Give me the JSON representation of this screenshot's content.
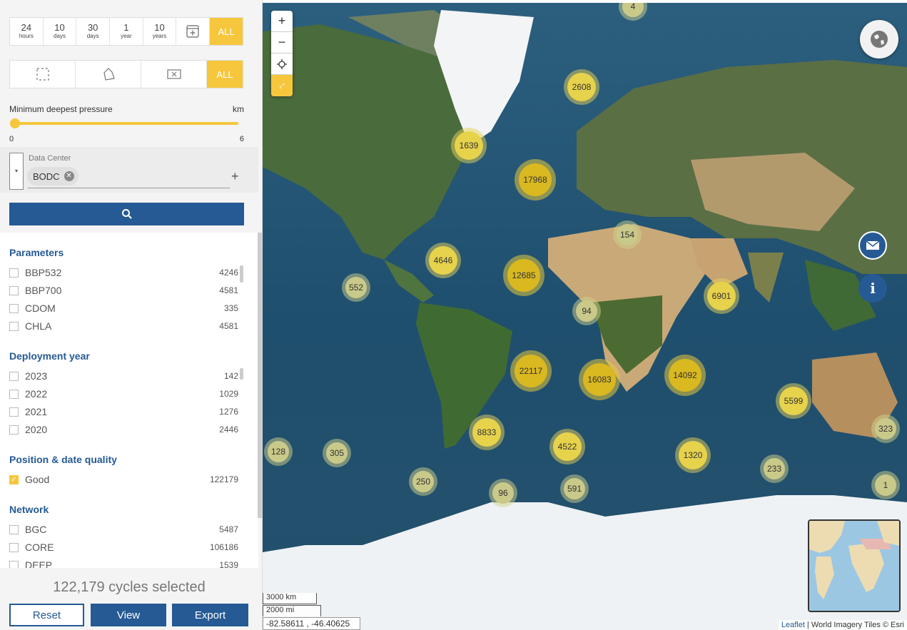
{
  "time_filter": {
    "options": [
      {
        "big": "24",
        "small": "hours"
      },
      {
        "big": "10",
        "small": "days"
      },
      {
        "big": "30",
        "small": "days"
      },
      {
        "big": "1",
        "small": "year"
      },
      {
        "big": "10",
        "small": "years"
      }
    ],
    "all_label": "ALL"
  },
  "shape_filter": {
    "all_label": "ALL"
  },
  "pressure": {
    "label": "Minimum deepest pressure",
    "unit": "km",
    "min": "0",
    "max": "6",
    "value": 0
  },
  "data_center": {
    "label": "Data Center",
    "chip": "BODC"
  },
  "facets": {
    "parameters": {
      "title": "Parameters",
      "items": [
        {
          "name": "BBP532",
          "count": "4246"
        },
        {
          "name": "BBP700",
          "count": "4581"
        },
        {
          "name": "CDOM",
          "count": "335"
        },
        {
          "name": "CHLA",
          "count": "4581"
        }
      ]
    },
    "deployment_year": {
      "title": "Deployment year",
      "items": [
        {
          "name": "2023",
          "count": "142"
        },
        {
          "name": "2022",
          "count": "1029"
        },
        {
          "name": "2021",
          "count": "1276"
        },
        {
          "name": "2020",
          "count": "2446"
        }
      ]
    },
    "quality": {
      "title": "Position & date quality",
      "items": [
        {
          "name": "Good",
          "count": "122179",
          "checked": true
        }
      ]
    },
    "network": {
      "title": "Network",
      "items": [
        {
          "name": "BGC",
          "count": "5487"
        },
        {
          "name": "CORE",
          "count": "106186"
        },
        {
          "name": "DEEP",
          "count": "1539"
        }
      ]
    }
  },
  "summary": {
    "cycles_selected": "122,179 cycles selected"
  },
  "actions": {
    "reset": "Reset",
    "view": "View",
    "export": "Export"
  },
  "map": {
    "zoom_in": "+",
    "zoom_out": "−",
    "clusters": [
      {
        "label": "4"
      },
      {
        "label": "2608"
      },
      {
        "label": "1639"
      },
      {
        "label": "17968"
      },
      {
        "label": "154"
      },
      {
        "label": "4646"
      },
      {
        "label": "12685"
      },
      {
        "label": "552"
      },
      {
        "label": "94"
      },
      {
        "label": "6901"
      },
      {
        "label": "22117"
      },
      {
        "label": "16083"
      },
      {
        "label": "14092"
      },
      {
        "label": "5599"
      },
      {
        "label": "323"
      },
      {
        "label": "8833"
      },
      {
        "label": "4522"
      },
      {
        "label": "128"
      },
      {
        "label": "305"
      },
      {
        "label": "1320"
      },
      {
        "label": "233"
      },
      {
        "label": "250"
      },
      {
        "label": "96"
      },
      {
        "label": "591"
      },
      {
        "label": "1"
      }
    ],
    "scale_km": "3000 km",
    "scale_mi": "2000 mi",
    "coordinates": "-82.58611 , -46.40625",
    "attribution_link": "Leaflet",
    "attribution_text": " | World Imagery Tiles © Esri"
  },
  "colors": {
    "accent": "#f6c73c",
    "primary": "#255a94"
  }
}
